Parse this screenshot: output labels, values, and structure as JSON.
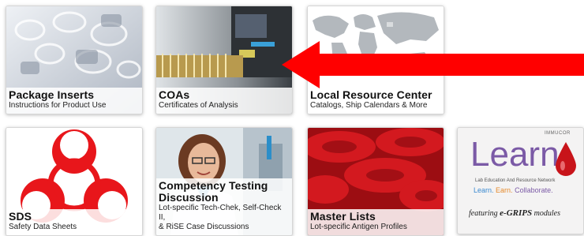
{
  "tiles": {
    "package_inserts": {
      "title": "Package Inserts",
      "subtitle": "Instructions for Product Use"
    },
    "coas": {
      "title": "COAs",
      "subtitle": "Certificates of Analysis"
    },
    "local_resource_center": {
      "title": "Local Resource Center",
      "subtitle": "Catalogs, Ship Calendars & More"
    },
    "sds": {
      "title": "SDS",
      "subtitle": "Safety Data Sheets"
    },
    "competency": {
      "title_line1": "Competency Testing",
      "title_line2": "Discussion",
      "subtitle_line1": "Lot-specific Tech-Chek, Self-Check II,",
      "subtitle_line2": "& RiSE Case Discussions"
    },
    "master_lists": {
      "title": "Master Lists",
      "subtitle": "Lot-specific Antigen Profiles"
    },
    "learn": {
      "brand": "IMMUCOR",
      "logo_text": "Learn",
      "network": "Lab Education And Resource Network",
      "tagline_learn": "Learn.",
      "tagline_earn": "Earn.",
      "tagline_collab": "Collaborate.",
      "featuring": "featuring",
      "grips": "e-GRIPS",
      "modules": "modules"
    }
  },
  "icons": {
    "biohazard": "biohazard-icon",
    "pointer_arrow": "red-arrow-icon"
  },
  "colors": {
    "arrow_red": "#ff0000",
    "biohazard_red": "#e8161b",
    "learn_purple": "#7b5aa6",
    "learn_blue": "#3b8ad0",
    "learn_orange": "#e58a2b",
    "blood_red": "#c8141a"
  }
}
